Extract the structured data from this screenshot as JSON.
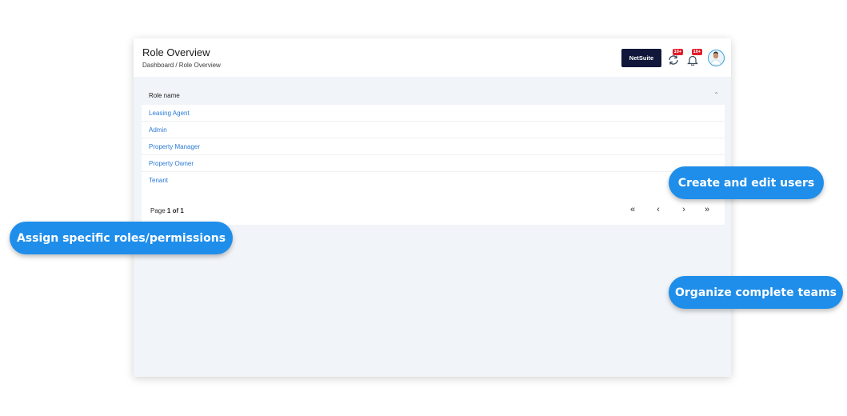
{
  "header": {
    "title": "Role Overview",
    "breadcrumb": "Dashboard / Role Overview",
    "netsuite_label": "NetSuite",
    "sync_badge": "10+",
    "notification_badge": "10+"
  },
  "table": {
    "column_header": "Role name",
    "rows": [
      "Leasing Agent",
      "Admin",
      "Property Manager",
      "Property Owner",
      "Tenant"
    ]
  },
  "pagination": {
    "prefix": "Page",
    "current": "1 of 1"
  },
  "callouts": {
    "roles": "Assign specific roles/permissions",
    "users": "Create and edit users",
    "teams": "Organize complete teams"
  },
  "colors": {
    "accent": "#1f8eea",
    "link": "#2b7bd6",
    "netsuite_button": "#10173a",
    "badge": "#e01e2b"
  },
  "icons": [
    "sync-icon",
    "bell-icon",
    "avatar",
    "sort-up-icon",
    "first-page-icon",
    "prev-page-icon",
    "next-page-icon",
    "last-page-icon"
  ]
}
